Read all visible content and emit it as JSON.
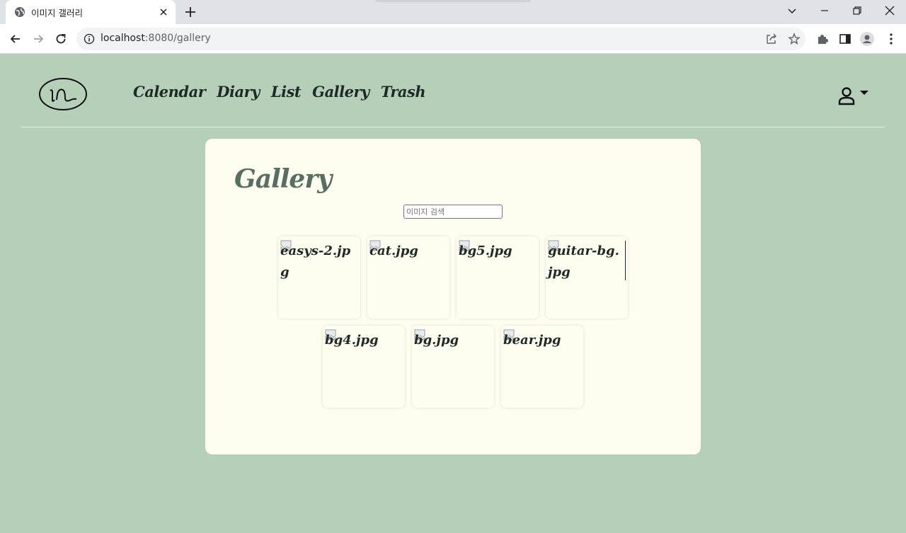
{
  "browser": {
    "tab_title": "이미지 갤러리",
    "url_host": "localhost",
    "url_rest": ":8080/gallery"
  },
  "nav": {
    "items": [
      "Calendar",
      "Diary",
      "List",
      "Gallery",
      "Trash"
    ]
  },
  "gallery": {
    "title": "Gallery",
    "search_placeholder": "이미지 검색",
    "rows": [
      [
        "easys-2.jpg",
        "cat.jpg",
        "bg5.jpg",
        "guitar-bg.jpg"
      ],
      [
        "bg4.jpg",
        "bg.jpg",
        "bear.jpg"
      ]
    ]
  },
  "colors": {
    "page_bg": "#b6cfb9",
    "card_bg": "#fdfdf0",
    "title_color": "#586e62",
    "nav_color": "#1f2a26"
  }
}
